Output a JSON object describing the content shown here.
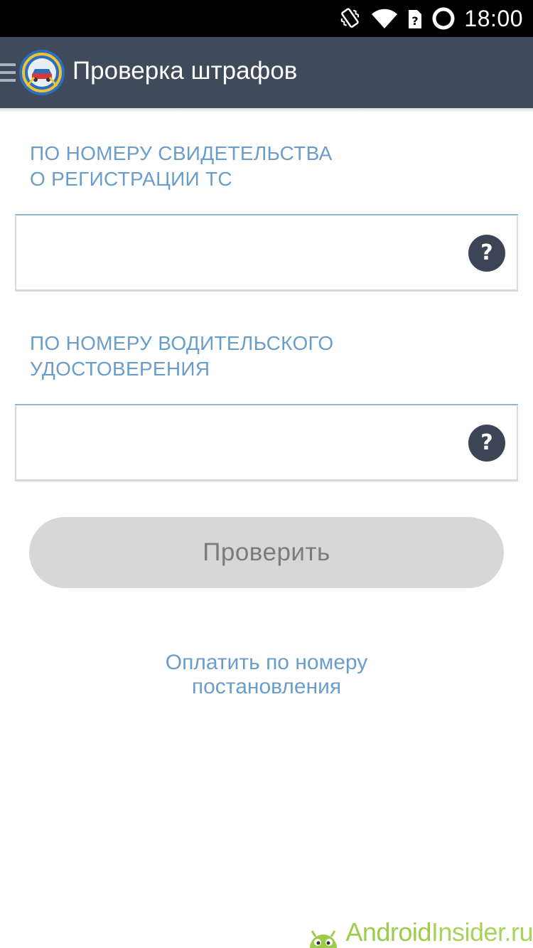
{
  "status_bar": {
    "time": "18:00",
    "icons": [
      "vibrate-icon",
      "wifi-icon",
      "no-sim-icon",
      "battery-ring-icon"
    ]
  },
  "action_bar": {
    "title": "Проверка штрафов",
    "logo": "traffic-police-emblem-icon",
    "menu": "menu-icon"
  },
  "form": {
    "vehicle_registration": {
      "title": "ПО НОМЕРУ СВИДЕТЕЛЬСТВА\nО РЕГИСТРАЦИИ ТС",
      "value": "",
      "help_label": "?"
    },
    "driver_license": {
      "title": "ПО НОМЕРУ ВОДИТЕЛЬСКОГО\nУДОСТОВЕРЕНИЯ",
      "value": "",
      "help_label": "?"
    },
    "check_button": "Проверить",
    "pay_link": "Оплатить по номеру\nпостановления"
  },
  "watermark": {
    "brand": "Android",
    "rest": "Insider.ru"
  },
  "colors": {
    "action_bar": "#3f4a5a",
    "accent_text": "#6b9dcb",
    "help_button": "#3c4555",
    "check_button_bg": "#d7d7d7",
    "watermark": "#9ccd49"
  }
}
